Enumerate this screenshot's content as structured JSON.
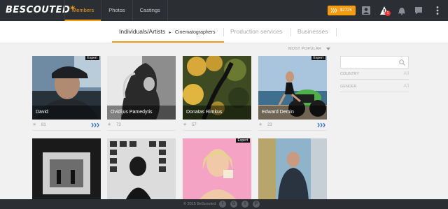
{
  "header": {
    "logo": "BESCOUTED",
    "logo_star": "*",
    "nav": [
      {
        "label": "Members",
        "active": true
      },
      {
        "label": "Photos",
        "active": false
      },
      {
        "label": "Castings",
        "active": false
      }
    ],
    "wallet_amount": "$2725",
    "notification_count": "1",
    "accent": "#f39c12"
  },
  "subnav": {
    "tabs": [
      {
        "label": "Individuals/Artists",
        "active": true,
        "sub": "Cinematographers"
      },
      {
        "label": "Production services",
        "active": false
      },
      {
        "label": "Businesses",
        "active": false
      }
    ]
  },
  "sort": {
    "label": "MOST POPULAR"
  },
  "filters": {
    "search_placeholder": "",
    "rows": [
      {
        "label": "COUNTRY",
        "value": "All"
      },
      {
        "label": "GENDER",
        "value": "All"
      }
    ]
  },
  "cards": [
    {
      "name": "David",
      "likes": "81",
      "expert": true,
      "expert_label": "Expert"
    },
    {
      "name": "Ovidijus Pamedytis",
      "likes": "73",
      "expert": false
    },
    {
      "name": "Donatas Rimkus",
      "likes": "57",
      "expert": false
    },
    {
      "name": "Edward Demin",
      "likes": "23",
      "expert": true,
      "expert_label": "Expert"
    },
    {
      "name": "",
      "likes": "",
      "expert": false
    },
    {
      "name": "",
      "likes": "",
      "expert": false
    },
    {
      "name": "",
      "likes": "",
      "expert": true,
      "expert_label": "Expert"
    },
    {
      "name": "",
      "likes": "",
      "expert": false
    }
  ],
  "footer": {
    "copyright": "© 2015 BeScouted",
    "social": [
      "f",
      "G",
      "t",
      "P"
    ]
  }
}
